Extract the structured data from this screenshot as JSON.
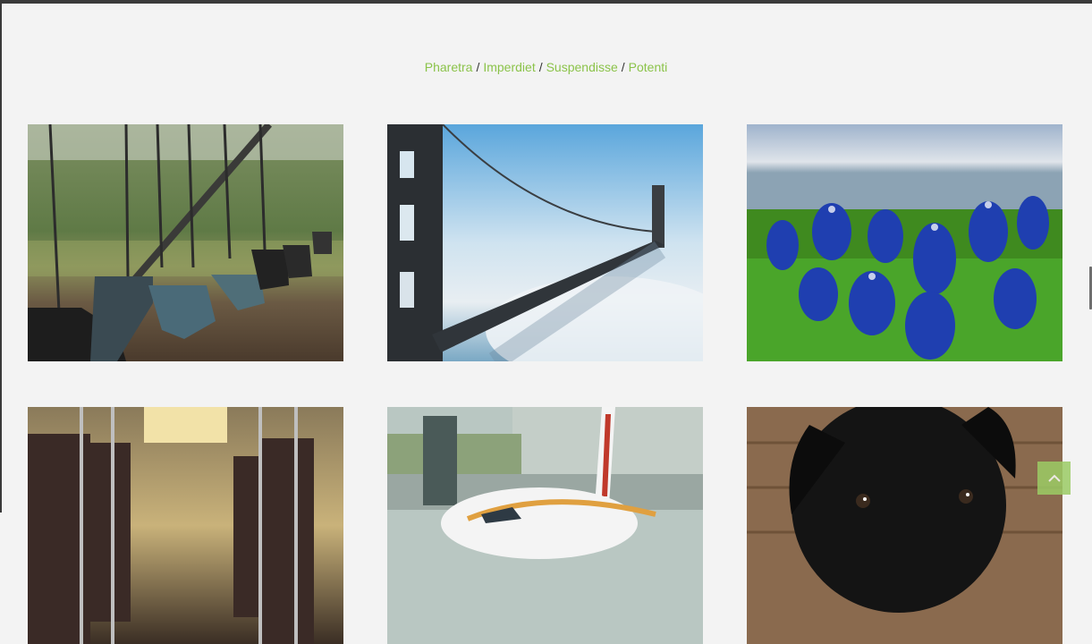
{
  "filters": [
    {
      "label": "Pharetra"
    },
    {
      "label": "Imperdiet"
    },
    {
      "label": "Suspendisse"
    },
    {
      "label": "Potenti"
    }
  ],
  "separator": "/",
  "accent_color": "#8bc34a",
  "gallery": [
    {
      "subject": "playground swings"
    },
    {
      "subject": "golden gate bridge in fog"
    },
    {
      "subject": "bluebonnet flowers"
    },
    {
      "subject": "bus interior seats"
    },
    {
      "subject": "airplane on runway"
    },
    {
      "subject": "black puppy"
    }
  ],
  "back_to_top_icon": "chevron-up-icon"
}
